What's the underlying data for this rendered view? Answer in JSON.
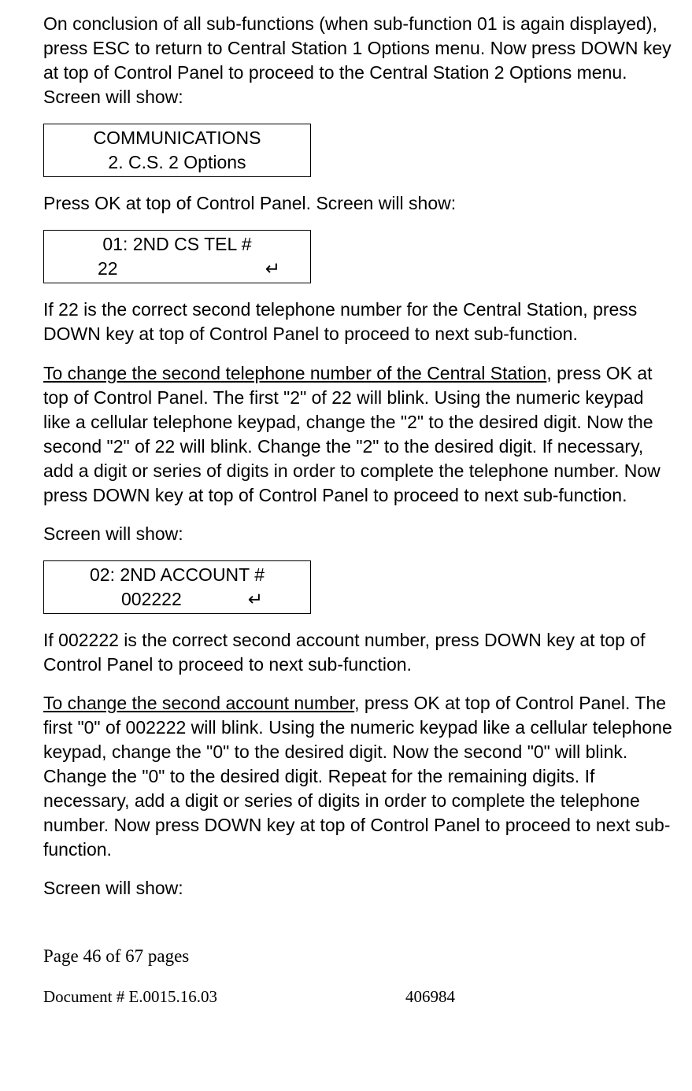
{
  "p1": "On conclusion of all sub-functions (when sub-function 01 is again displayed), press ESC to return to Central Station 1 Options menu. Now press DOWN key at top of Control Panel to proceed to the Central Station 2 Options menu. Screen will show:",
  "lcd1": {
    "line1": "COMMUNICATIONS",
    "line2": "2. C.S. 2 Options"
  },
  "p2": "Press OK at top of Control Panel. Screen will show:",
  "lcd2": {
    "line1": "01: 2ND CS TEL #",
    "val": "22",
    "ret": "↵"
  },
  "p3": "If 22 is the correct second telephone number for the Central Station, press DOWN key at top of Control Panel to proceed to next sub-function.",
  "p4u": "To change the second telephone number of the Central Station",
  "p4": ", press OK at top of Control Panel. The first \"2\" of 22 will blink. Using the numeric keypad like a cellular telephone keypad, change the \"2\" to the desired digit. Now the second \"2\" of 22 will blink. Change the \"2\" to the desired digit. If necessary, add a digit or series of digits in order to complete the telephone number. Now press DOWN key at top of Control Panel to proceed to next sub-function.",
  "p5": "Screen will show:",
  "lcd3": {
    "line1": "02: 2ND ACCOUNT #",
    "val": "002222",
    "ret": "↵"
  },
  "p6": "If 002222 is the correct second account number, press DOWN key at top of Control Panel to proceed to next sub-function.",
  "p7u": "To change the second account number",
  "p7": ", press OK at top of Control Panel. The first \"0\" of 002222 will blink. Using the numeric keypad like a cellular telephone keypad, change the \"0\" to the desired digit. Now the second \"0\" will blink. Change the \"0\" to the desired digit. Repeat for the remaining digits. If necessary, add a digit or series of digits in order to complete the telephone number. Now press DOWN key at top of Control Panel to proceed to next sub-function.",
  "p8": "Screen will show:",
  "footer": {
    "page": "Page 46 of  67 pages",
    "doc": "Document # E.0015.16.03",
    "num": "406984"
  }
}
